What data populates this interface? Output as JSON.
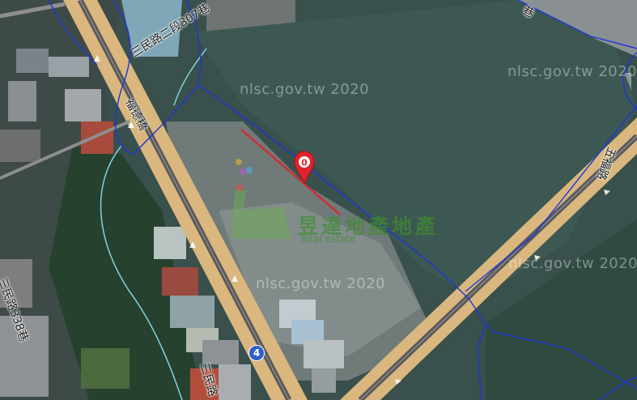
{
  "map": {
    "watermarks": [
      "nlsc.gov.tw 2020",
      "nlsc.gov.tw 2020",
      "nlsc.gov.tw 2020",
      "nlsc.gov.tw 2020"
    ],
    "road_labels": {
      "lane_307": "三民路二段307巷",
      "bridge": "福德橋",
      "lane_338": "三民路338巷",
      "sanmin_road": "三民路",
      "bottom_road": "仁",
      "right_road": "五福路",
      "top_corner": "巷"
    },
    "route_badge": "4",
    "brand": {
      "name": "昱達地產地產",
      "sub": "Real estate"
    },
    "marker": {
      "label": "0",
      "color": "#e0232b"
    }
  }
}
